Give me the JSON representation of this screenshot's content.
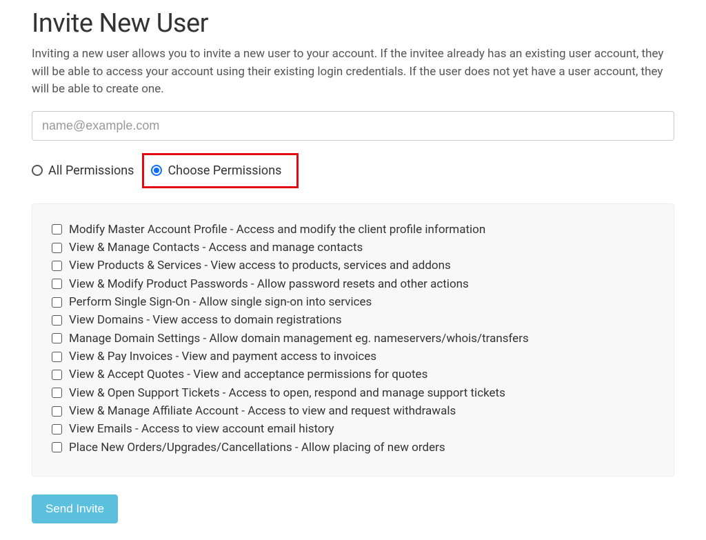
{
  "header": {
    "title": "Invite New User",
    "description": "Inviting a new user allows you to invite a new user to your account. If the invitee already has an existing user account, they will be able to access your account using their existing login credentials. If the user does not yet have a user account, they will be able to create one."
  },
  "email": {
    "value": "",
    "placeholder": "name@example.com"
  },
  "perm_choice": {
    "all_label": "All Permissions",
    "choose_label": "Choose Permissions"
  },
  "permissions": [
    "Modify Master Account Profile - Access and modify the client profile information",
    "View & Manage Contacts - Access and manage contacts",
    "View Products & Services - View access to products, services and addons",
    "View & Modify Product Passwords - Allow password resets and other actions",
    "Perform Single Sign-On - Allow single sign-on into services",
    "View Domains - View access to domain registrations",
    "Manage Domain Settings - Allow domain management eg. nameservers/whois/transfers",
    "View & Pay Invoices - View and payment access to invoices",
    "View & Accept Quotes - View and acceptance permissions for quotes",
    "View & Open Support Tickets - Access to open, respond and manage support tickets",
    "View & Manage Affiliate Account - Access to view and request withdrawals",
    "View Emails - Access to view account email history",
    "Place New Orders/Upgrades/Cancellations - Allow placing of new orders"
  ],
  "actions": {
    "send_invite": "Send Invite"
  },
  "colors": {
    "accent_blue": "#0d6efd",
    "button_teal": "#5bc0de",
    "highlight_red": "#e30613"
  }
}
